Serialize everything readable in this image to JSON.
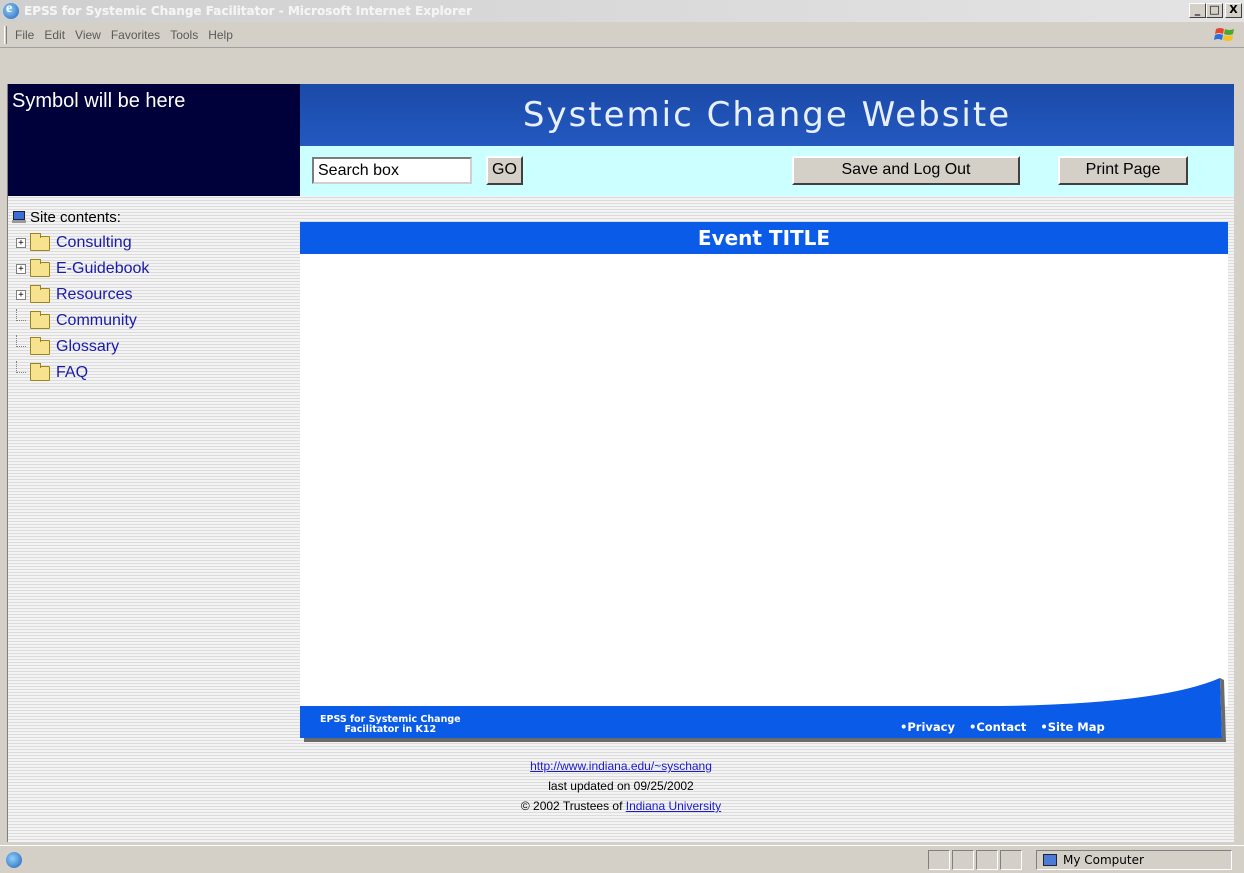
{
  "window": {
    "title": "EPSS for Systemic Change Facilitator - Microsoft Internet Explorer",
    "minimize": "_",
    "maximize": "□",
    "close": "X"
  },
  "menu": [
    "File",
    "Edit",
    "View",
    "Favorites",
    "Tools",
    "Help"
  ],
  "header": {
    "symbol_text": "Symbol will be here",
    "site_title": "Systemic Change Website",
    "search_value": "Search box",
    "go_label": "GO",
    "save_logout_label": "Save and Log Out",
    "print_label": "Print Page"
  },
  "sidebar": {
    "heading": "Site contents:",
    "items": [
      {
        "label": "Consulting",
        "expandable": true
      },
      {
        "label": "E-Guidebook",
        "expandable": true
      },
      {
        "label": "Resources",
        "expandable": true
      },
      {
        "label": "Community",
        "expandable": false
      },
      {
        "label": "Glossary",
        "expandable": false
      },
      {
        "label": "FAQ",
        "expandable": false
      }
    ]
  },
  "main": {
    "event_title": "Event TITLE"
  },
  "footer": {
    "left_line1": "EPSS for Systemic Change",
    "left_line2": "Facilitator in K12",
    "links": [
      "•Privacy",
      "•Contact",
      "•Site Map"
    ]
  },
  "bottom": {
    "url": "http://www.indiana.edu/~syschang",
    "updated": "last updated on 09/25/2002",
    "copyright_prefix": "© 2002 Trustees of ",
    "university": "Indiana University"
  },
  "status": {
    "zone": "My Computer"
  }
}
